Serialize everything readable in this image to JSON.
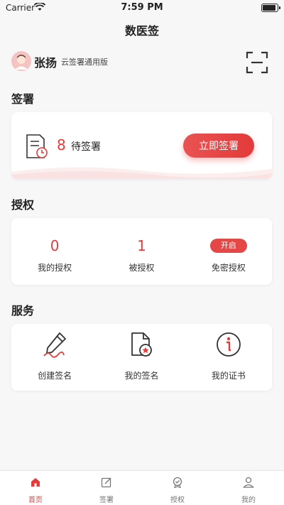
{
  "status_bar": {
    "carrier": "Carrier",
    "time": "7:59 PM"
  },
  "header": {
    "title": "数医签"
  },
  "user": {
    "name": "张扬",
    "version": "云签署通用版"
  },
  "sign_section": {
    "title": "签署",
    "pending_count": "8",
    "pending_label": "待签署",
    "sign_now_label": "立即签署"
  },
  "auth_section": {
    "title": "授权",
    "my_auth_count": "0",
    "my_auth_label": "我的授权",
    "authorized_count": "1",
    "authorized_label": "被授权",
    "secret_free_status": "开启",
    "secret_free_label": "免密授权"
  },
  "service_section": {
    "title": "服务",
    "create_signature_label": "创建签名",
    "my_signature_label": "我的签名",
    "my_certificate_label": "我的证书"
  },
  "tab_bar": {
    "home": "首页",
    "sign": "签署",
    "auth": "授权",
    "mine": "我的"
  },
  "colors": {
    "accent": "#e53b3b",
    "background": "#f7f7f8"
  }
}
